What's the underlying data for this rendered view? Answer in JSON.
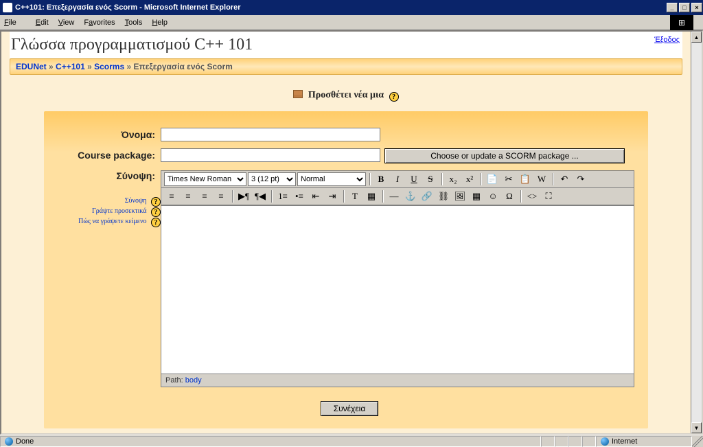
{
  "window": {
    "title": "C++101: Επεξεργασία ενός Scorm - Microsoft Internet Explorer",
    "menu": {
      "file": "File",
      "edit": "Edit",
      "view": "View",
      "favorites": "Favorites",
      "tools": "Tools",
      "help": "Help"
    },
    "status": {
      "done": "Done",
      "zone": "Internet"
    }
  },
  "header": {
    "course_title": "Γλώσσα προγραμματισμού C++ 101",
    "logout": "Έξοδος"
  },
  "breadcrumb": {
    "edunet": "EDUNet",
    "course": "C++101",
    "scorms": "Scorms",
    "current": "Επεξεργασία ενός Scorm",
    "sep": "»"
  },
  "heading": "Προσθέτει νέα μια",
  "form": {
    "name_label": "Όνομα:",
    "name_value": "",
    "package_label": "Course package:",
    "package_value": "",
    "choose_button": "Choose or update a SCORM package ...",
    "summary_label": "Σύνοψη:"
  },
  "editor": {
    "font_family": "Times New Roman",
    "font_size": "3 (12 pt)",
    "style": "Normal",
    "body": "",
    "path_label": "Path:",
    "path_value": "body"
  },
  "help_links": {
    "l1": "Σύνοψη",
    "l2": "Γράψτε προσεκτικά",
    "l3": "Πώς να γράψετε κείμενο"
  },
  "buttons": {
    "continue": "Συνέχεια"
  }
}
